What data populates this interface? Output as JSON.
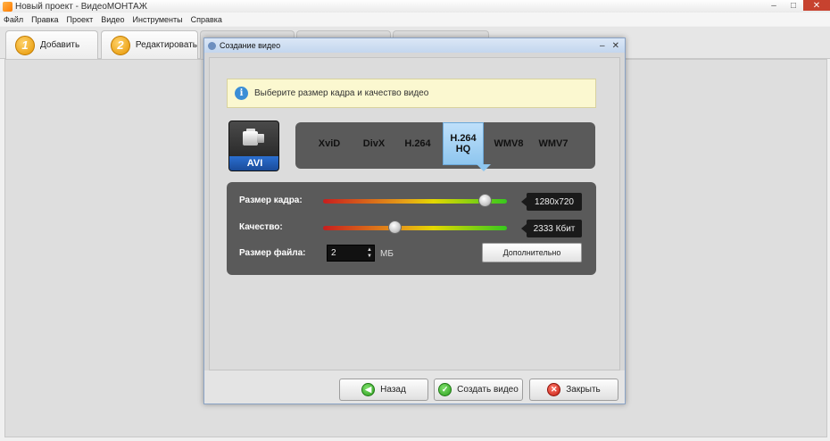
{
  "window": {
    "title": "Новый проект - ВидеоМОНТАЖ",
    "controls": {
      "minimize": "–",
      "maximize": "□",
      "close": "✕"
    }
  },
  "menu": [
    "Файл",
    "Правка",
    "Проект",
    "Видео",
    "Инструменты",
    "Справка"
  ],
  "tabs": [
    {
      "number": "1",
      "label": "Добавить"
    },
    {
      "number": "2",
      "label": "Редактировать"
    }
  ],
  "dialog": {
    "title": "Создание видео",
    "controls": {
      "minimize": "–",
      "close": "✕"
    },
    "info_text": "Выберите размер кадра и качество видео",
    "format_label": "AVI",
    "codecs": [
      "XviD",
      "DivX",
      "H.264",
      "H.264\nHQ",
      "WMV8",
      "WMV7"
    ],
    "selected_codec": "H.264 HQ",
    "frame_size": {
      "label": "Размер кадра:",
      "value": "1280x720",
      "level": 0.88
    },
    "quality": {
      "label": "Качество:",
      "value": "2333 Кбит",
      "level": 0.39
    },
    "file_size": {
      "label": "Размер файла:",
      "value": "2",
      "unit": "МБ"
    },
    "advanced_button": "Дополнительно",
    "footer": {
      "back": "Назад",
      "create": "Создать видео",
      "close": "Закрыть"
    }
  },
  "colors": {
    "accent_selected": "#8ec6ef",
    "panel_bg": "#5a5a5a",
    "info_bg": "#fbf8d0"
  }
}
